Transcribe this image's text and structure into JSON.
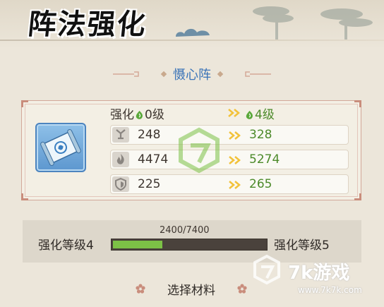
{
  "header": {
    "title": "阵法强化"
  },
  "formation": {
    "name": "慑心阵"
  },
  "levels": {
    "label": "强化",
    "current": "0级",
    "next": "4级"
  },
  "stats": [
    {
      "icon": "attack-icon",
      "current": "248",
      "next": "328"
    },
    {
      "icon": "flame-icon",
      "current": "4474",
      "next": "5274"
    },
    {
      "icon": "shield-icon",
      "current": "225",
      "next": "265"
    }
  ],
  "progress": {
    "from_label": "强化等级4",
    "to_label": "强化等级5",
    "exp_text": "2400/7400",
    "fraction": 0.3243
  },
  "materials": {
    "label": "选择材料"
  },
  "watermark": {
    "brand": "7k游戏",
    "url": "www.7k7k.com"
  },
  "colors": {
    "accent_blue": "#3b74b8",
    "upgrade_green": "#4c8a2a",
    "bar_fill": "#7cc146",
    "arrow_yellow": "#f2c23a"
  }
}
